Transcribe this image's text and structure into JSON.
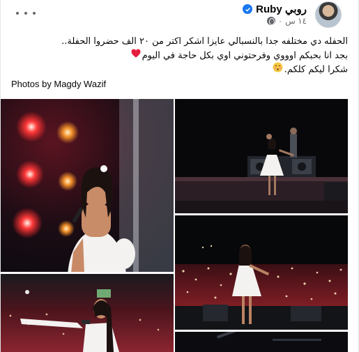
{
  "post": {
    "author_name": "Ruby روبي",
    "time": "١٤ س",
    "text_lines": [
      "الحفله دي مختلفه جدا بالنسبالي عايزا اشكر اكتر من ٢٠ الف حضروا الحفلة..",
      "بجد انا بحبكم اوووي وفرحتوني اوي بكل حاجة في اليوم",
      "شكرا ليكم كلكم."
    ],
    "photo_credit": "Photos by Magdy Wazif",
    "icons": {
      "more": "more-horizontal-icon",
      "verified": "verified-badge-icon",
      "audience": "globe-icon",
      "heart": "red-heart-emoji",
      "smile": "blushing-smile-emoji"
    },
    "colors": {
      "accent": "#1877f2",
      "secondary_text": "#65676b",
      "heart": "#e41e3f"
    }
  }
}
